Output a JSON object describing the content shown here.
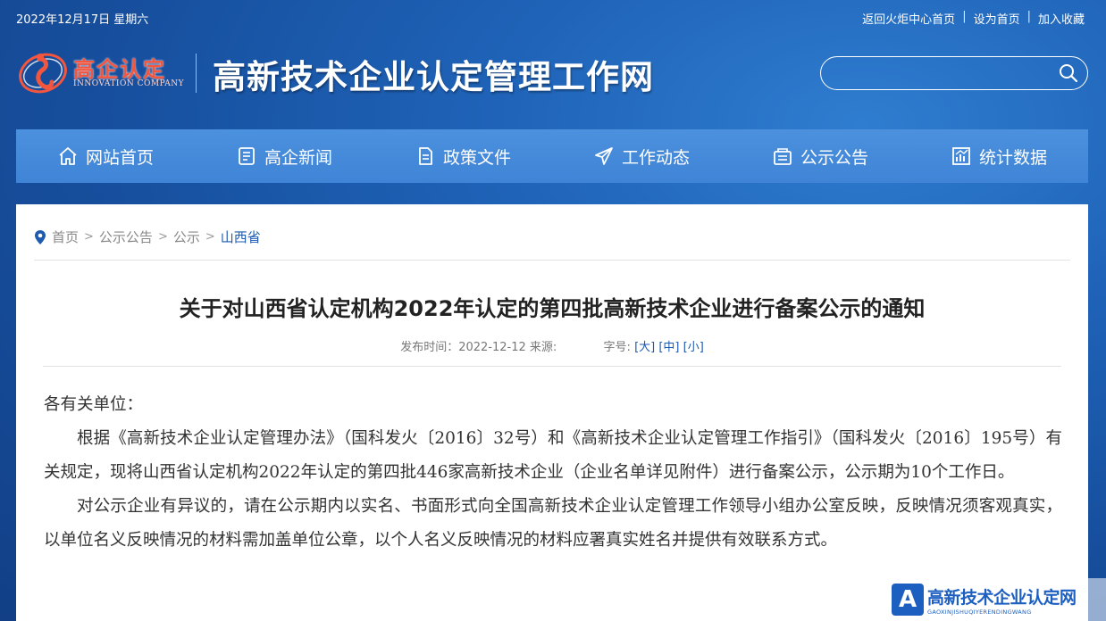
{
  "topbar": {
    "date": "2022年12月17日 星期六",
    "links": [
      "返回火炬中心首页",
      "设为首页",
      "加入收藏"
    ],
    "separator": "|"
  },
  "header": {
    "logo_text": "高企认定",
    "logo_subtext": "INNOVATION COMPANY",
    "site_title": "高新技术企业认定管理工作网",
    "search_placeholder": ""
  },
  "nav": [
    {
      "label": "网站首页",
      "icon": "home-icon"
    },
    {
      "label": "高企新闻",
      "icon": "news-icon"
    },
    {
      "label": "政策文件",
      "icon": "document-icon"
    },
    {
      "label": "工作动态",
      "icon": "paper-plane-icon"
    },
    {
      "label": "公示公告",
      "icon": "notice-box-icon"
    },
    {
      "label": "统计数据",
      "icon": "chart-icon"
    }
  ],
  "breadcrumb": {
    "items": [
      "首页",
      "公示公告",
      "公示"
    ],
    "current": "山西省",
    "separator": ">"
  },
  "article": {
    "title": "关于对山西省认定机构2022年认定的第四批高新技术企业进行备案公示的通知",
    "meta_published": "发布时间：2022-12-12 来源:",
    "meta_fontsize_label": "字号:",
    "font_sizes": [
      "[大]",
      "[中]",
      "[小]"
    ],
    "paragraphs": [
      "各有关单位：",
      "根据《高新技术企业认定管理办法》（国科发火〔2016〕32号）和《高新技术企业认定管理工作指引》（国科发火〔2016〕195号）有关规定，现将山西省认定机构2022年认定的第四批446家高新技术企业（企业名单详见附件）进行备案公示，公示期为10个工作日。",
      "对公示企业有异议的，请在公示期内以实名、书面形式向全国高新技术企业认定管理工作领导小组办公室反映，反映情况须客观真实，以单位名义反映情况的材料需加盖单位公章，以个人名义反映情况的材料应署真实姓名并提供有效联系方式。"
    ]
  },
  "watermark": {
    "logo_letter": "A",
    "main": "高新技术企业认定网",
    "sub": "GAOXINJISHUQIYERENDINGWANG"
  },
  "colors": {
    "nav_bg": "#4289d8",
    "page_bg": "#1a57a8",
    "link_blue": "#1e5bb0",
    "logo_red": "#f3563f"
  }
}
